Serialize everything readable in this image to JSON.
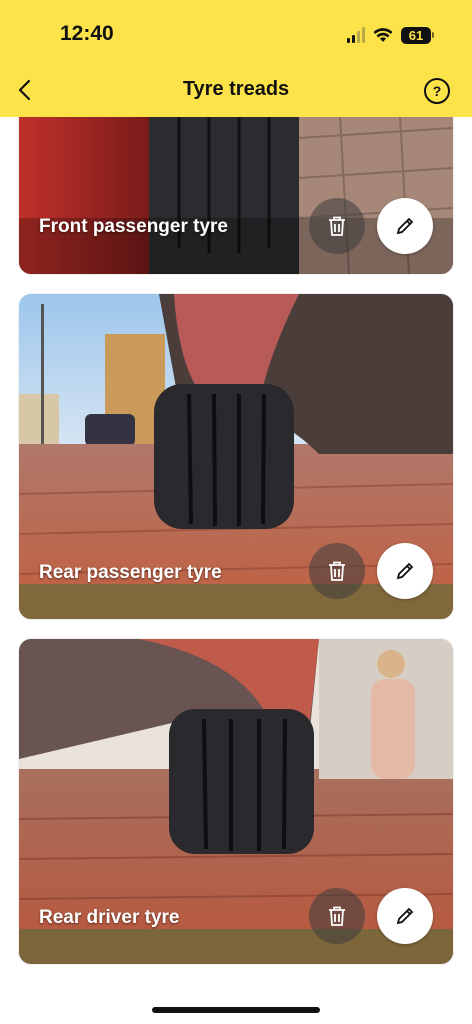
{
  "status_bar": {
    "time": "12:40",
    "battery": "61"
  },
  "nav": {
    "title": "Tyre treads",
    "back_icon": "chevron-left-icon",
    "help_icon": "question-circle-icon"
  },
  "cards": [
    {
      "label": "Front passenger tyre",
      "delete_icon": "trash-icon",
      "edit_icon": "pencil-icon"
    },
    {
      "label": "Rear passenger tyre",
      "delete_icon": "trash-icon",
      "edit_icon": "pencil-icon"
    },
    {
      "label": "Rear driver tyre",
      "delete_icon": "trash-icon",
      "edit_icon": "pencil-icon"
    }
  ],
  "colors": {
    "header": "#fde34a",
    "text": "#111111"
  }
}
